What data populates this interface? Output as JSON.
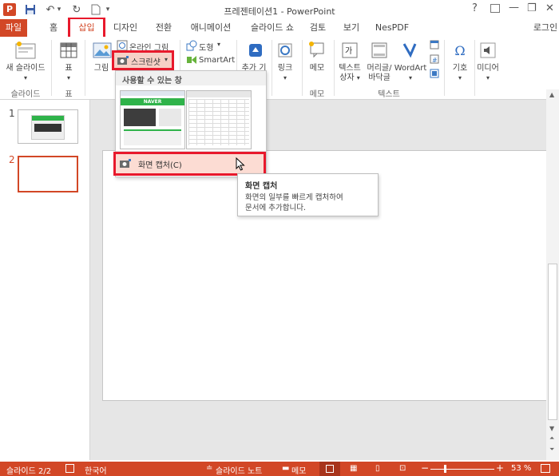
{
  "window": {
    "title": "프레젠테이션1 - PowerPoint",
    "help": "?",
    "minimize": "—",
    "restore": "❐",
    "close": "✕",
    "account": "로그인"
  },
  "quick_access": {
    "app_icon_letter": "P",
    "save_glyph": "💾",
    "undo_glyph": "↶",
    "undo_arrow": "▾",
    "redo_glyph": "↻",
    "new_glyph": "🗋",
    "customize_glyph": "▾"
  },
  "tabs": [
    {
      "label": "파일"
    },
    {
      "label": "홈"
    },
    {
      "label": "삽입"
    },
    {
      "label": "디자인"
    },
    {
      "label": "전환"
    },
    {
      "label": "애니메이션"
    },
    {
      "label": "슬라이드 쇼"
    },
    {
      "label": "검토"
    },
    {
      "label": "보기"
    },
    {
      "label": "NesPDF"
    }
  ],
  "ribbon": {
    "new_slide": "새 슬라이드",
    "new_slide_arrow": "▾",
    "slides_group": "슬라이드",
    "table": "표",
    "table_arrow": "▾",
    "picture": "그림",
    "online_picture": "온라인 그림",
    "screenshot": "스크린샷",
    "screenshot_arrow": "▾",
    "shapes": "도형",
    "shapes_arrow": "▾",
    "smartart": "SmartArt",
    "addin": "추가 기",
    "link": "링크",
    "link_arrow": "▾",
    "memo": "메모",
    "memo_group": "메모",
    "textbox_line1": "텍스트",
    "textbox_line2": "상자",
    "textbox_arrow": "▾",
    "headerfooter_line1": "머리글/",
    "headerfooter_line2": "바닥글",
    "wordart": "WordArt",
    "wordart_arrow": "▾",
    "text_group": "텍스트",
    "symbol": "기호",
    "symbol_arrow": "▾",
    "media": "미디어",
    "media_arrow": "▾",
    "collapse": "▲"
  },
  "dropdown": {
    "header": "사용할 수 있는 창",
    "screen_clip": "화면 캡처(C)"
  },
  "tooltip": {
    "title": "화면 캡처",
    "line1": "화면의 일부를 빠르게 캡처하여",
    "line2": "문서에 추가합니다."
  },
  "thumbnails": [
    {
      "number": "1"
    },
    {
      "number": "2"
    }
  ],
  "thumb_banner": "NAVER",
  "statusbar": {
    "slide_info": "슬라이드 2/2",
    "language": "한국어",
    "notes": "슬라이드 노트",
    "comments": "메모",
    "zoom_out": "−",
    "zoom_in": "+",
    "zoom": "53 %",
    "zoom_level": 0.53
  },
  "colors": {
    "accent": "#d24726",
    "highlight": "#e8192c",
    "thumbnail_selected": "#d24726"
  }
}
